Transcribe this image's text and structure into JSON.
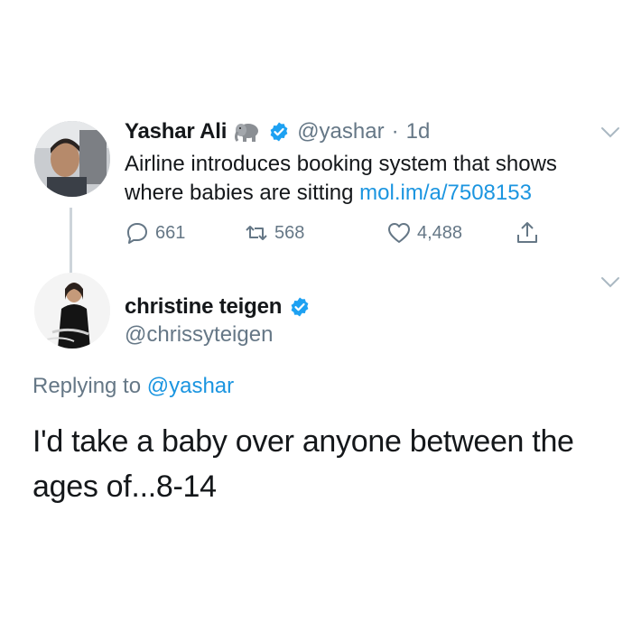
{
  "tweet1": {
    "author_name": "Yashar Ali",
    "emoji_icon": "elephant-icon",
    "verified_icon": "verified-badge-icon",
    "handle": "@yashar",
    "separator": "·",
    "time": "1d",
    "text": "Airline introduces booking system that shows where babies are sitting ",
    "link_text": "mol.im/a/7508153",
    "actions": {
      "reply_count": "661",
      "retweet_count": "568",
      "like_count": "4,488"
    }
  },
  "tweet2": {
    "author_name": "christine teigen",
    "verified_icon": "verified-badge-icon",
    "handle": "@chrissyteigen",
    "replying_prefix": "Replying to ",
    "replying_to": "@yashar",
    "text": "I'd take a baby over anyone between the ages of...8-14"
  },
  "colors": {
    "link": "#1b95e0",
    "secondary_text": "#657786",
    "primary_text": "#14171a",
    "thread_line": "#cdd4da"
  }
}
